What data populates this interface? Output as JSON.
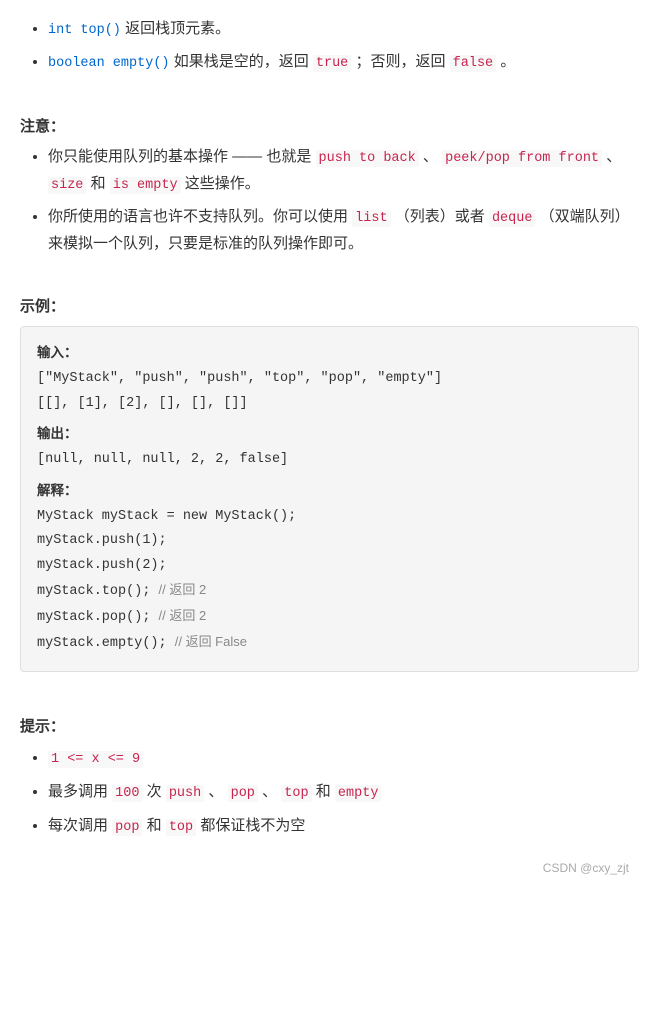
{
  "top_bullets": [
    {
      "code": "int top()",
      "text": "返回栈顶元素。"
    },
    {
      "code": "boolean empty()",
      "text_before": "如果栈是空的，返回",
      "code2": "true",
      "text_mid": "；否则，返回",
      "code3": "false",
      "text_after": "。"
    }
  ],
  "note_section": {
    "title": "注意：",
    "items": [
      {
        "text_before": "你只能使用队列的基本操作 —— 也就是",
        "code1": "push to back",
        "text_mid": "、",
        "code2": "peek/pop from front",
        "text_mid2": "、",
        "code3": "size",
        "text_mid3": "和",
        "code4": "is empty",
        "text_after": "这些操作。"
      },
      {
        "text_before": "你所使用的语言也许不支持队列。你可以使用",
        "code1": "list",
        "text_mid": "（列表）或者",
        "code2": "deque",
        "text_after": "（双端队列）来模拟一个队列，只要是标准的队列操作即可。"
      }
    ]
  },
  "example_section": {
    "title": "示例：",
    "code_block": {
      "input_label": "输入：",
      "input_line1": "[\"MyStack\", \"push\", \"push\", \"top\", \"pop\", \"empty\"]",
      "input_line2": "[[], [1], [2], [], [], []]",
      "output_label": "输出：",
      "output_line1": "[null, null, null, 2, 2, false]",
      "explain_label": "解释：",
      "code_lines": [
        "MyStack myStack = new MyStack();",
        "myStack.push(1);",
        "myStack.push(2);",
        "myStack.top();   // 返回 2",
        "myStack.pop();   // 返回 2",
        "myStack.empty(); // 返回 False"
      ]
    }
  },
  "hint_section": {
    "title": "提示：",
    "items": [
      {
        "code": "1 <= x <= 9"
      },
      {
        "text_before": "最多调用",
        "code1": "100",
        "text_mid": "次",
        "code2": "push",
        "sep1": "、",
        "code3": "pop",
        "sep2": "、",
        "code4": "top",
        "text_mid2": "和",
        "code5": "empty"
      },
      {
        "text_before": "每次调用",
        "code1": "pop",
        "text_mid": "和",
        "code2": "top",
        "text_after": "都保证栈不为空"
      }
    ]
  },
  "watermark": "CSDN @cxy_zjt"
}
